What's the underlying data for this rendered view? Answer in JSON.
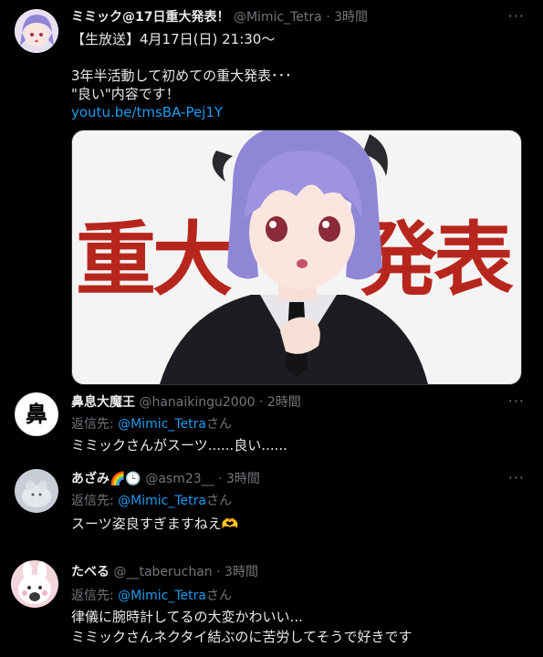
{
  "tweets": [
    {
      "name": "ミミック@17日重大発表！",
      "handle": "@Mimic_Tetra",
      "time": "3時間",
      "more": "···",
      "lines": [
        "【生放送】4月17日(日) 21:30〜",
        "3年半活動して初めての重大発表･･･",
        "\"良い\"内容です！"
      ],
      "link": "youtu.be/tmsBA-Pej1Y",
      "media_text_left": "重大",
      "media_text_right": "発表"
    },
    {
      "name": "鼻息大魔王",
      "handle": "@hanaikingu2000",
      "time": "2時間",
      "more": "···",
      "avatar_char": "鼻",
      "reply_prefix": "返信先: ",
      "reply_to": "@Mimic_Tetra",
      "reply_suffix": "さん",
      "text": "ミミックさんがスーツ......良い......"
    },
    {
      "name": "あざみ🌈🕒",
      "handle": "@asm23__",
      "time": "3時間",
      "more": "···",
      "reply_prefix": "返信先: ",
      "reply_to": "@Mimic_Tetra",
      "reply_suffix": "さん",
      "text": "スーツ姿良すぎますねえ🫶"
    },
    {
      "name": "たべる",
      "handle": "@__taberuchan",
      "time": "3時間",
      "reply_prefix": "返信先: ",
      "reply_to": "@Mimic_Tetra",
      "reply_suffix": "さん",
      "lines": [
        "律儀に腕時計してるの大変かわいい...",
        "ミミックさんネクタイ結ぶのに苦労してそうで好きです"
      ]
    }
  ],
  "colors": {
    "background": "#000000",
    "text": "#e7e9ea",
    "muted": "#71767b",
    "link": "#1d9bf0",
    "media_red": "#b7261c"
  }
}
